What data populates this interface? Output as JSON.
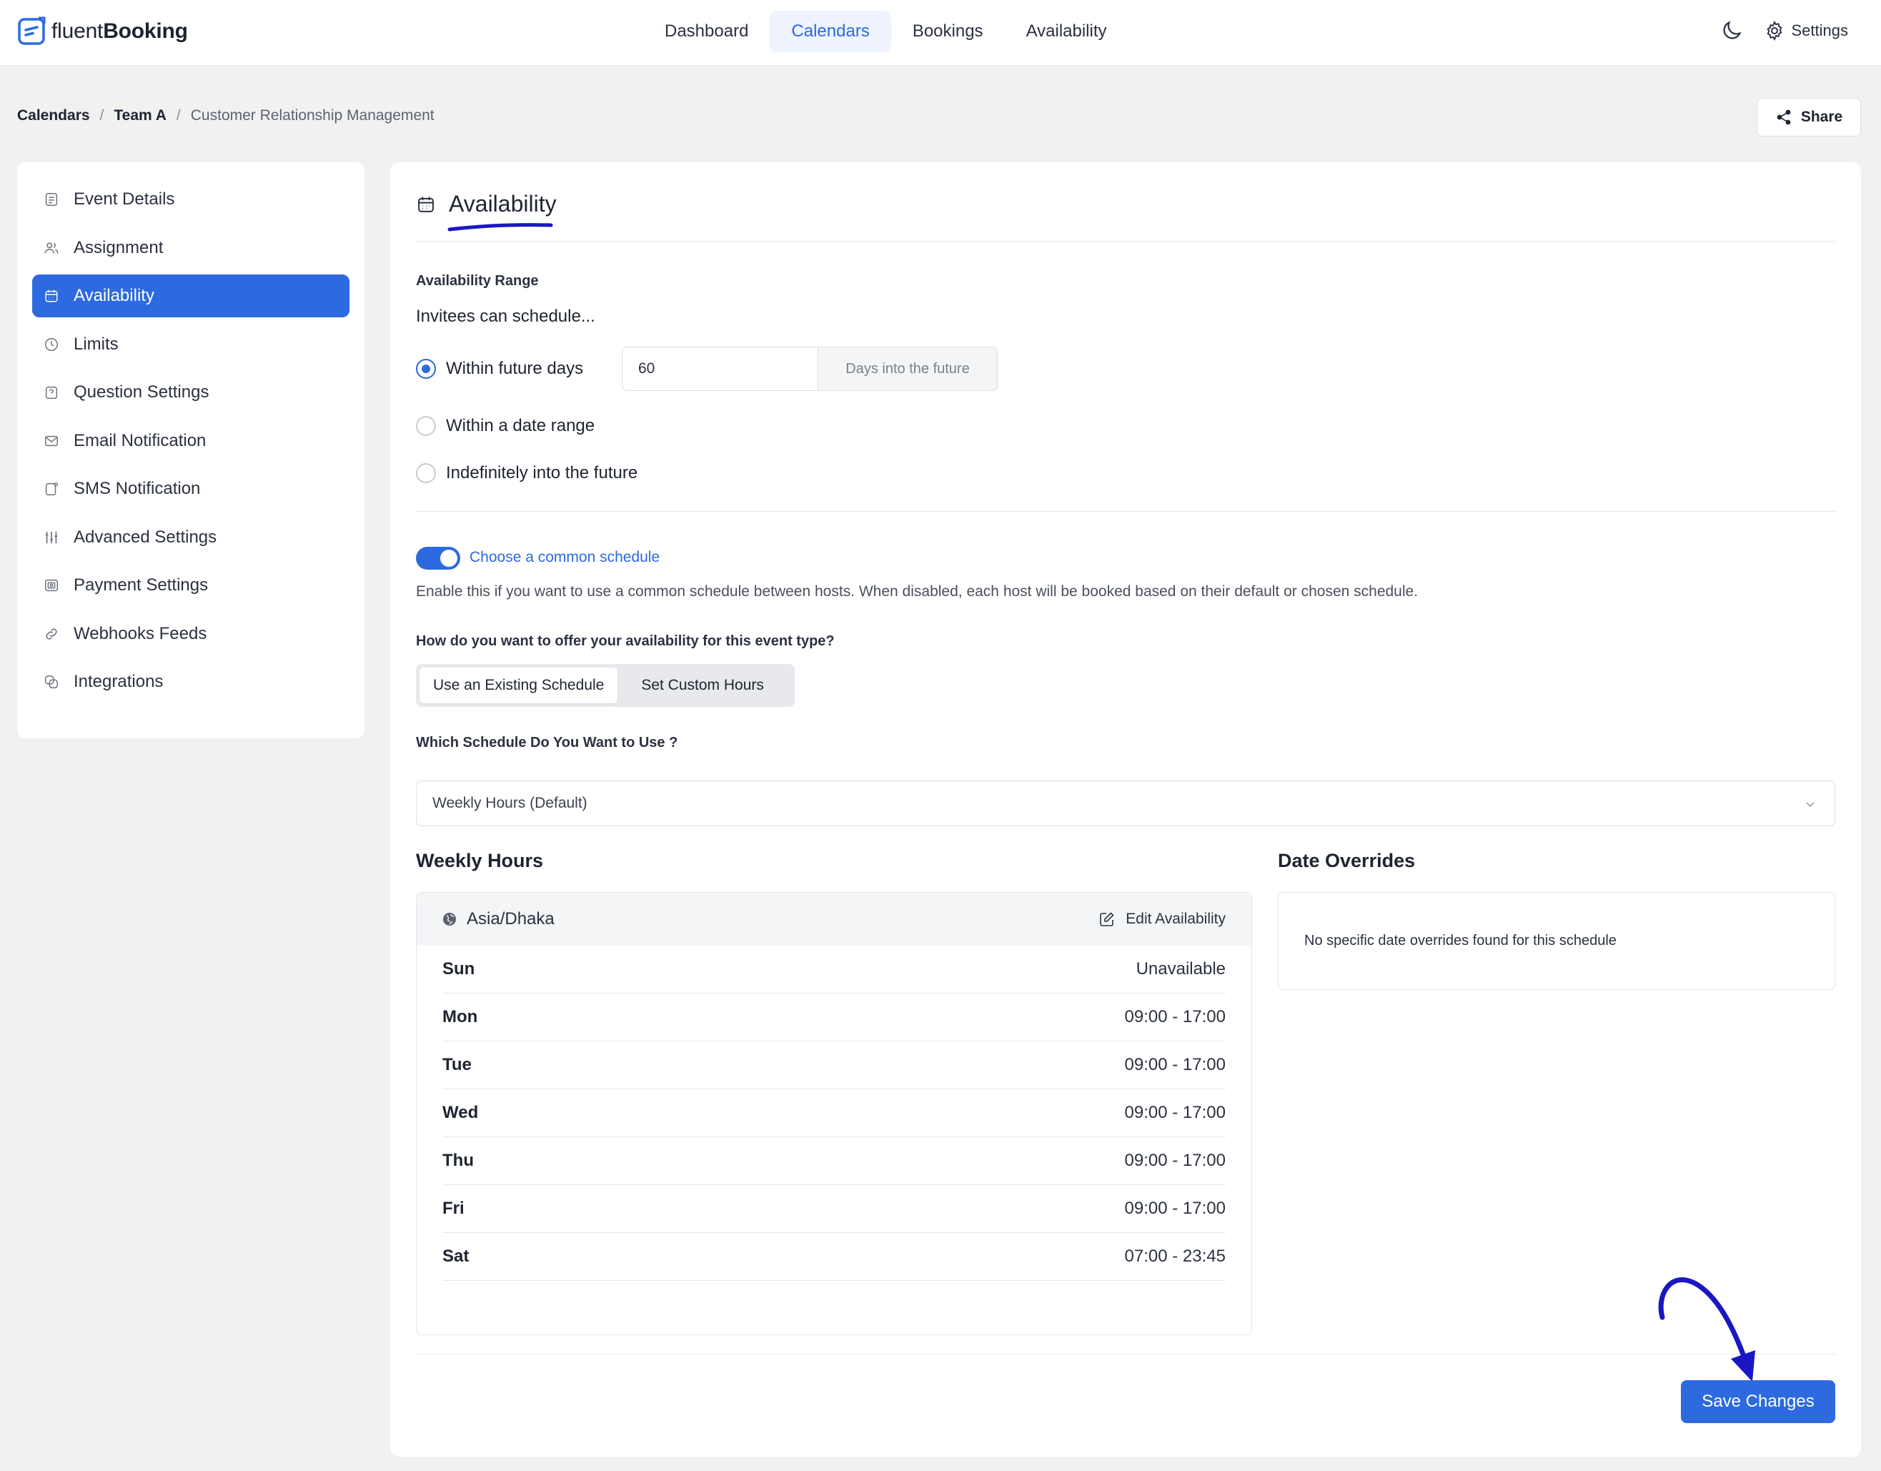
{
  "app": {
    "logo_light": "fluent",
    "logo_bold": "Booking"
  },
  "nav": {
    "items": [
      {
        "label": "Dashboard",
        "active": false
      },
      {
        "label": "Calendars",
        "active": true
      },
      {
        "label": "Bookings",
        "active": false
      },
      {
        "label": "Availability",
        "active": false
      }
    ],
    "settings_label": "Settings"
  },
  "breadcrumb": {
    "items": [
      "Calendars",
      "Team A",
      "Customer Relationship Management"
    ],
    "separator": "/"
  },
  "share_label": "Share",
  "sidebar": {
    "items": [
      {
        "label": "Event Details",
        "icon": "document-icon"
      },
      {
        "label": "Assignment",
        "icon": "users-icon"
      },
      {
        "label": "Availability",
        "icon": "calendar-icon",
        "active": true
      },
      {
        "label": "Limits",
        "icon": "clock-icon"
      },
      {
        "label": "Question Settings",
        "icon": "question-icon"
      },
      {
        "label": "Email Notification",
        "icon": "mail-icon"
      },
      {
        "label": "SMS Notification",
        "icon": "message-icon"
      },
      {
        "label": "Advanced Settings",
        "icon": "sliders-icon"
      },
      {
        "label": "Payment Settings",
        "icon": "payment-icon"
      },
      {
        "label": "Webhooks Feeds",
        "icon": "link-icon"
      },
      {
        "label": "Integrations",
        "icon": "integrations-icon"
      }
    ]
  },
  "main": {
    "title": "Availability",
    "range_label": "Availability Range",
    "invitees_label": "Invitees can schedule...",
    "options": [
      {
        "label": "Within future days",
        "checked": true
      },
      {
        "label": "Within a date range",
        "checked": false
      },
      {
        "label": "Indefinitely into the future",
        "checked": false
      }
    ],
    "days_value": "60",
    "days_suffix": "Days into the future",
    "common_schedule_label": "Choose a common schedule",
    "common_schedule_enabled": true,
    "common_schedule_help": "Enable this if you want to use a common schedule between hosts. When disabled, each host will be booked based on their default or chosen schedule.",
    "offer_question": "How do you want to offer your availability for this event type?",
    "offer_options": [
      "Use an Existing Schedule",
      "Set Custom Hours"
    ],
    "offer_selected": "Use an Existing Schedule",
    "schedule_question": "Which Schedule Do You Want to Use ?",
    "schedule_selected": "Weekly Hours (Default)",
    "weekly_title": "Weekly Hours",
    "timezone": "Asia/Dhaka",
    "edit_label": "Edit Availability",
    "days": [
      {
        "day": "Sun",
        "hours": "Unavailable"
      },
      {
        "day": "Mon",
        "hours": "09:00 - 17:00"
      },
      {
        "day": "Tue",
        "hours": "09:00 - 17:00"
      },
      {
        "day": "Wed",
        "hours": "09:00 - 17:00"
      },
      {
        "day": "Thu",
        "hours": "09:00 - 17:00"
      },
      {
        "day": "Fri",
        "hours": "09:00 - 17:00"
      },
      {
        "day": "Sat",
        "hours": "07:00 - 23:45"
      }
    ],
    "overrides_title": "Date Overrides",
    "overrides_empty": "No specific date overrides found for this schedule",
    "save_label": "Save Changes"
  },
  "colors": {
    "accent": "#2d6adf",
    "annotation": "#1a17c2",
    "background": "#f1f1f2"
  }
}
